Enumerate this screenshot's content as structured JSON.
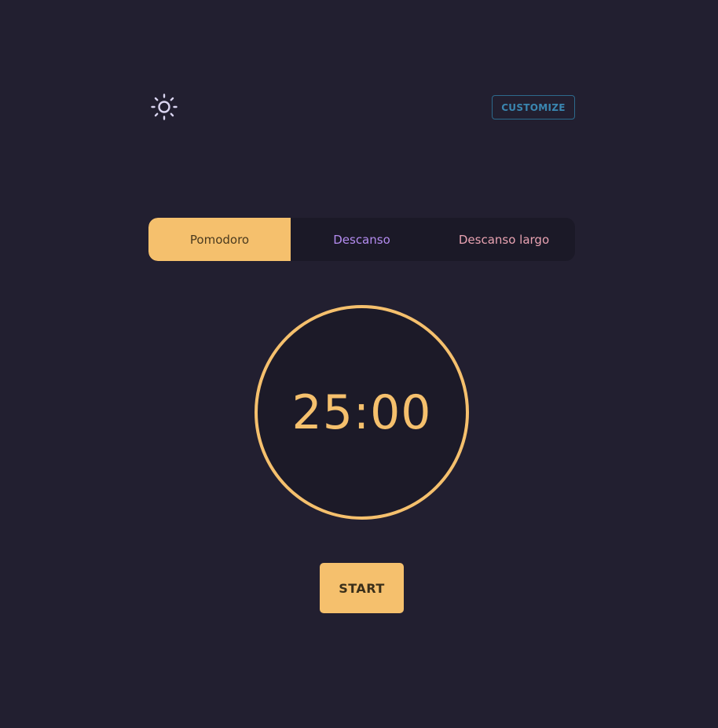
{
  "header": {
    "theme_icon": "sun-icon",
    "customize_label": "CUSTOMIZE"
  },
  "modes": {
    "tabs": [
      {
        "label": "Pomodoro",
        "active": true
      },
      {
        "label": "Descanso",
        "active": false
      },
      {
        "label": "Descanso largo",
        "active": false
      }
    ]
  },
  "timer": {
    "display": "25:00"
  },
  "controls": {
    "start_label": "START"
  },
  "colors": {
    "background": "#221f30",
    "accent": "#f5c06d",
    "customize": "#3a86b0",
    "descanso": "#b48cf0",
    "descanso_largo": "#e9a3b2"
  }
}
